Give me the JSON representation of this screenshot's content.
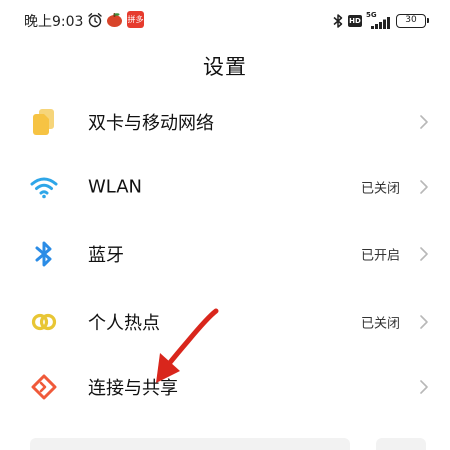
{
  "status_bar": {
    "time": "晚上9:03",
    "alarm_icon": "alarm-clock-icon",
    "app_badge": "拼多",
    "hd": "HD",
    "network": "5G",
    "battery": "30"
  },
  "title": "设置",
  "rows": [
    {
      "label": "双卡与移动网络",
      "value": "",
      "icon": "sim-card-icon",
      "icon_color": "#f6c343"
    },
    {
      "label": "WLAN",
      "value": "已关闭",
      "icon": "wifi-icon",
      "icon_color": "#2ea6e8"
    },
    {
      "label": "蓝牙",
      "value": "已开启",
      "icon": "bluetooth-icon",
      "icon_color": "#2b8ce6"
    },
    {
      "label": "个人热点",
      "value": "已关闭",
      "icon": "hotspot-icon",
      "icon_color": "#e8c635"
    },
    {
      "label": "连接与共享",
      "value": "",
      "icon": "connection-share-icon",
      "icon_color": "#f05a3a"
    }
  ],
  "colors": {
    "arrow": "#d9261c",
    "chevron": "#b8b8b8"
  }
}
